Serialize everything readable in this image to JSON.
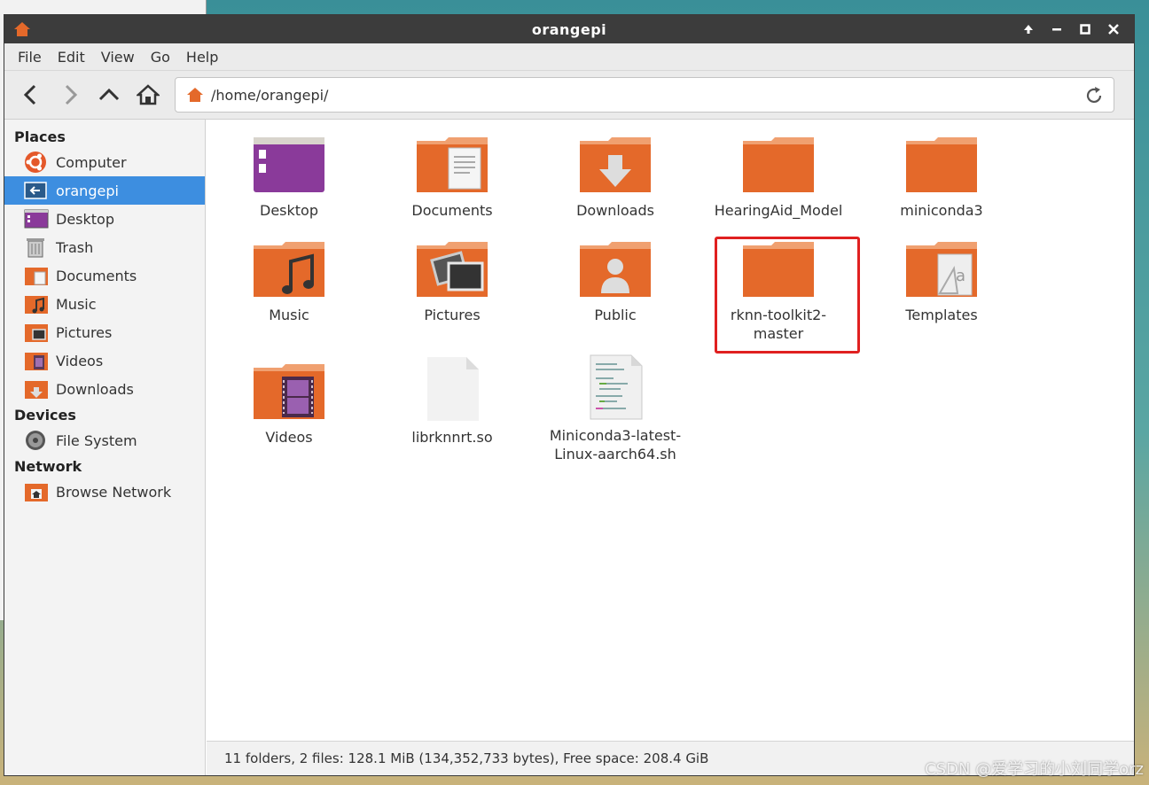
{
  "window": {
    "title": "orangepi"
  },
  "menu": [
    "File",
    "Edit",
    "View",
    "Go",
    "Help"
  ],
  "address": {
    "path": "/home/orangepi/"
  },
  "sidebar": {
    "places_header": "Places",
    "places": [
      {
        "label": "Computer",
        "icon": "computer-icon"
      },
      {
        "label": "orangepi",
        "icon": "home-folder-icon",
        "active": true
      },
      {
        "label": "Desktop",
        "icon": "desktop-icon"
      },
      {
        "label": "Trash",
        "icon": "trash-icon"
      },
      {
        "label": "Documents",
        "icon": "documents-folder-icon"
      },
      {
        "label": "Music",
        "icon": "music-folder-icon"
      },
      {
        "label": "Pictures",
        "icon": "pictures-folder-icon"
      },
      {
        "label": "Videos",
        "icon": "videos-folder-icon"
      },
      {
        "label": "Downloads",
        "icon": "downloads-folder-icon"
      }
    ],
    "devices_header": "Devices",
    "devices": [
      {
        "label": "File System",
        "icon": "drive-icon"
      }
    ],
    "network_header": "Network",
    "network": [
      {
        "label": "Browse Network",
        "icon": "network-icon"
      }
    ]
  },
  "files": [
    {
      "label": "Desktop",
      "icon": "desktop-folder-icon"
    },
    {
      "label": "Documents",
      "icon": "documents-folder-icon"
    },
    {
      "label": "Downloads",
      "icon": "downloads-folder-icon"
    },
    {
      "label": "HearingAid_Model",
      "icon": "folder-icon"
    },
    {
      "label": "miniconda3",
      "icon": "folder-icon"
    },
    {
      "label": "Music",
      "icon": "music-folder-icon"
    },
    {
      "label": "Pictures",
      "icon": "pictures-folder-icon"
    },
    {
      "label": "Public",
      "icon": "public-folder-icon"
    },
    {
      "label": "rknn-toolkit2-\nmaster",
      "icon": "folder-icon",
      "highlighted": true
    },
    {
      "label": "Templates",
      "icon": "templates-folder-icon"
    },
    {
      "label": "Videos",
      "icon": "videos-folder-icon"
    },
    {
      "label": "librknnrt.so",
      "icon": "file-icon"
    },
    {
      "label": "Miniconda3-latest-\nLinux-aarch64.sh",
      "icon": "script-file-icon"
    }
  ],
  "status": {
    "text": "11 folders, 2 files: 128.1 MiB (134,352,733 bytes), Free space: 208.4 GiB"
  },
  "watermark": "CSDN @爱学习的小刘同学orz",
  "colors": {
    "accent": "#3d8ee0",
    "folder": "#e4692a",
    "highlight": "#e02020",
    "titlebar": "#3c3c3c"
  }
}
